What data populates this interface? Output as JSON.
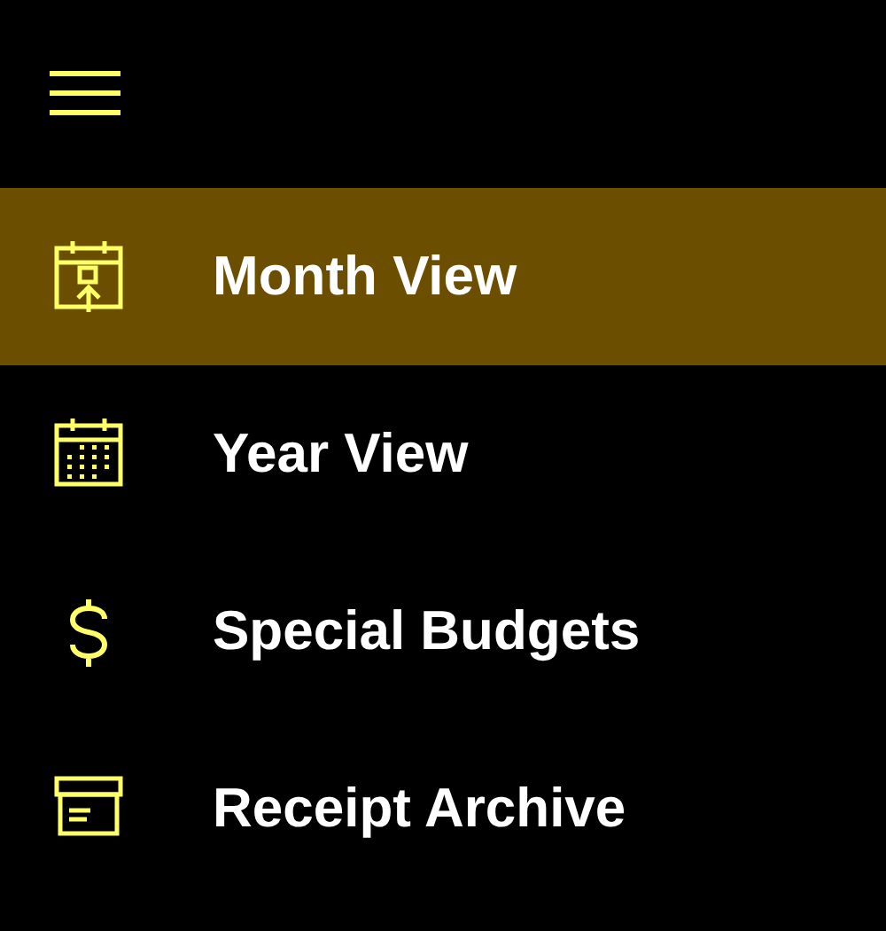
{
  "menu_items": [
    {
      "label": "Month View",
      "selected": true
    },
    {
      "label": "Year View",
      "selected": false
    },
    {
      "label": "Special Budgets",
      "selected": false
    },
    {
      "label": "Receipt Archive",
      "selected": false
    }
  ]
}
